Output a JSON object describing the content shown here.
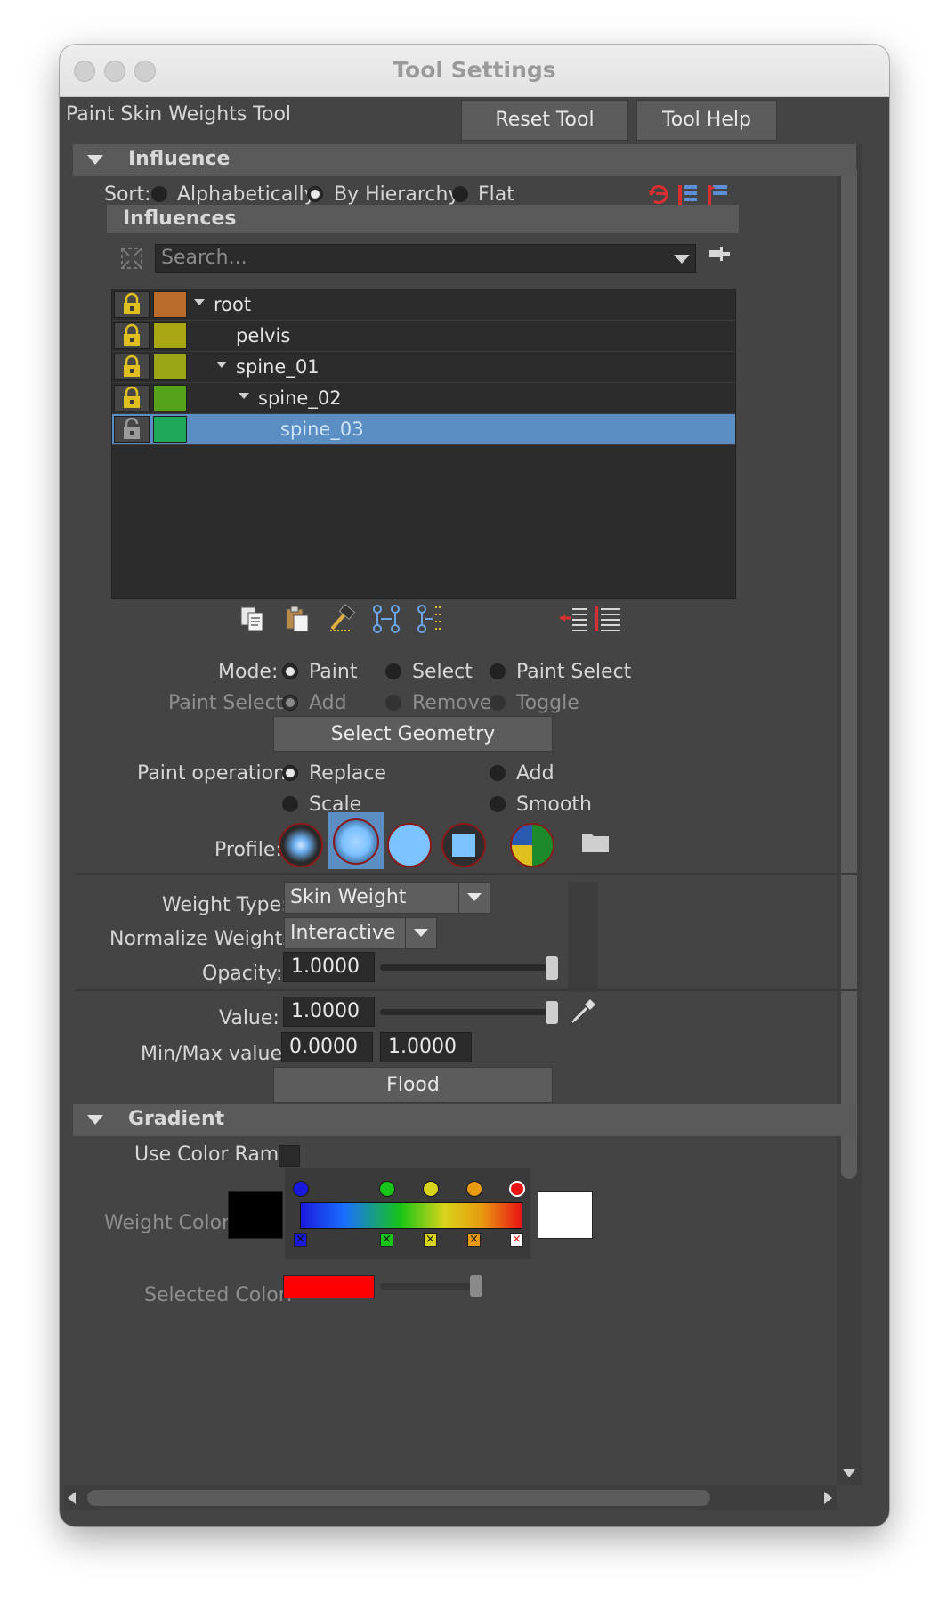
{
  "window": {
    "title": "Tool Settings"
  },
  "header": {
    "tool_name": "Paint Skin Weights Tool",
    "reset_label": "Reset Tool",
    "help_label": "Tool Help"
  },
  "influence": {
    "section_label": "Influence",
    "sort_label": "Sort:",
    "sort_options": [
      "Alphabetically",
      "By Hierarchy",
      "Flat"
    ],
    "sort_selected": "By Hierarchy",
    "influences_label": "Influences",
    "search_placeholder": "Search...",
    "items": [
      {
        "name": "root",
        "color": "#b86b2a",
        "locked": true,
        "expanded": true,
        "depth": 0
      },
      {
        "name": "pelvis",
        "color": "#a9a614",
        "locked": true,
        "expanded": false,
        "depth": 1
      },
      {
        "name": "spine_01",
        "color": "#9aa616",
        "locked": true,
        "expanded": true,
        "depth": 1
      },
      {
        "name": "spine_02",
        "color": "#55a31a",
        "locked": true,
        "expanded": true,
        "depth": 2
      },
      {
        "name": "spine_03",
        "color": "#1fa85a",
        "locked": false,
        "expanded": false,
        "depth": 3,
        "selected": true
      }
    ]
  },
  "mode": {
    "label": "Mode:",
    "options": [
      "Paint",
      "Select",
      "Paint Select"
    ],
    "selected": "Paint",
    "paint_select_label": "Paint Select:",
    "paint_select_options": [
      "Add",
      "Remove",
      "Toggle"
    ],
    "select_geometry_label": "Select Geometry"
  },
  "paint_operation": {
    "label": "Paint operation:",
    "options": [
      "Replace",
      "Add",
      "Scale",
      "Smooth"
    ],
    "selected": "Replace"
  },
  "profile": {
    "label": "Profile:",
    "selected_index": 1
  },
  "weights": {
    "weight_type_label": "Weight Type:",
    "weight_type_value": "Skin Weight",
    "normalize_label": "Normalize Weights:",
    "normalize_value": "Interactive",
    "opacity_label": "Opacity:",
    "opacity_value": "1.0000",
    "opacity_level": 1.0,
    "value_label": "Value:",
    "value_value": "1.0000",
    "value_level": 1.0,
    "minmax_label": "Min/Max value:",
    "min_value": "0.0000",
    "max_value": "1.0000",
    "flood_label": "Flood"
  },
  "gradient": {
    "section_label": "Gradient",
    "use_color_ramp_label": "Use Color Ramp",
    "weight_color_label": "Weight Color:",
    "selected_color_label": "Selected Color:",
    "ramp_stop_colors": [
      "#1a1adc",
      "#18c418",
      "#d8d41a",
      "#e89a10",
      "#e81414"
    ],
    "selected_color": "#ff0000"
  }
}
